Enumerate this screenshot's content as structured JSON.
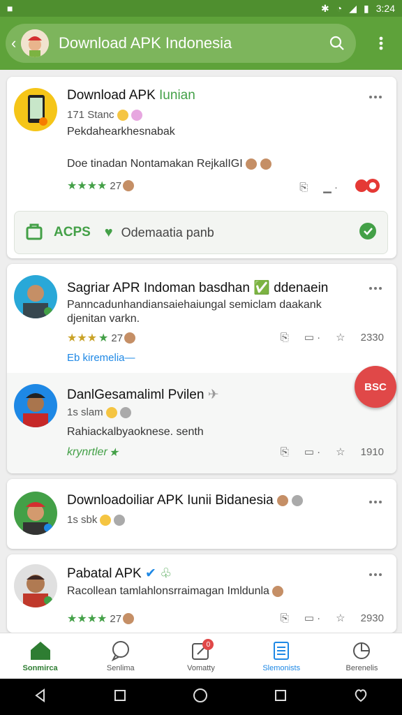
{
  "status": {
    "time": "3:24"
  },
  "header": {
    "title": "Download APK Indonesia"
  },
  "posts": [
    {
      "title": "Download APK",
      "title_tag": "Iunian",
      "meta": "171 Stanc",
      "text1": "Pekdahearkhesnabak",
      "text2": "Doe tinadan Nontamakan RejkalIGI",
      "rating": "27",
      "subbar_label": "ACPS",
      "subbar_text": "Odemaatia panb"
    },
    {
      "title": "Sagriar APR Indoman basdhan",
      "title_tag": "ddenaein",
      "text1": "Panncadunhandiansaiehaiungal semiclam daakank",
      "text2": "djenitan varkn.",
      "rating": "27",
      "link": "Eb kiremelia",
      "count": "2330"
    },
    {
      "title": "DanlGesamaliml Pvilen",
      "meta": "1s slam",
      "text1": "Rahiackalbyaoknese. senth",
      "footer": "krynrtler",
      "count": "1910",
      "badge": "BSC"
    },
    {
      "title": "Downloadoiliar APK Iunii Bidanesia",
      "meta": "1s sbk"
    },
    {
      "title": "Pabatal APK",
      "text1": "Racollean tamlahlonsrraimagan Imldunla",
      "rating": "27",
      "count": "2930"
    }
  ],
  "nav": [
    {
      "label": "Sonmirca",
      "icon": "home-icon"
    },
    {
      "label": "Senlima",
      "icon": "chat-icon"
    },
    {
      "label": "Vomatty",
      "icon": "edit-icon",
      "badge": "0"
    },
    {
      "label": "Slemonists",
      "icon": "list-icon"
    },
    {
      "label": "Berenelis",
      "icon": "pie-icon"
    }
  ],
  "colors": {
    "primary": "#5ea23a",
    "accent": "#43a047",
    "badge": "#e04848"
  }
}
